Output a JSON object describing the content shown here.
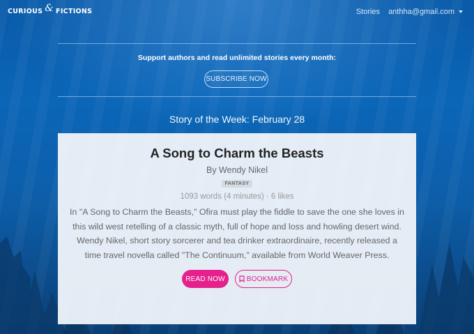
{
  "nav": {
    "logo_left": "CURIOUS",
    "logo_amp": "&",
    "logo_right": "FICTIONS",
    "stories_link": "Stories",
    "account_email": "anthha@gmail.com"
  },
  "promo": {
    "support_text": "Support authors and read unlimited stories every month:",
    "subscribe_label": "SUBSCRIBE NOW"
  },
  "story_of_week": {
    "heading": "Story of the Week: February 28",
    "title": "A Song to Charm the Beasts",
    "author": "By Wendy Nikel",
    "genre_tag": "FANTASY",
    "meta": "1093 words (4 minutes) · 6 likes",
    "blurb": "In \"A Song to Charm the Beasts,\" Ofira must play the fiddle to save the one she loves in this wild west retelling of a classic myth, full of hope and loss and howling desert wind. Wendy Nikel, short story sorcerer and tea drinker extraordinaire, recently released a time travel novella called \"The Continuum,\" available from World Weaver Press.",
    "read_label": "READ NOW",
    "bookmark_label": "BOOKMARK"
  },
  "colors": {
    "accent_pink": "#e6208c",
    "background_blue": "#0b66b8"
  }
}
